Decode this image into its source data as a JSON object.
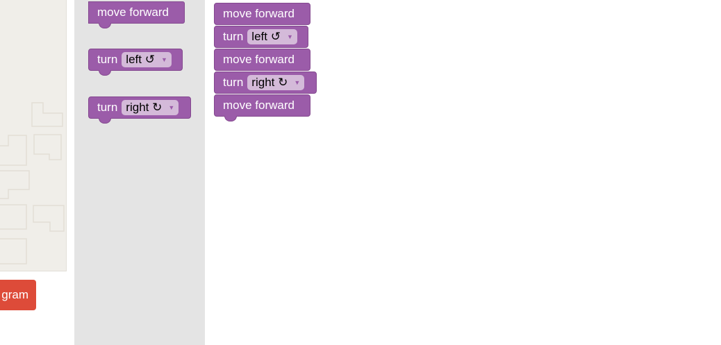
{
  "run_button": {
    "label": "gram"
  },
  "toolbox": {
    "blocks": [
      {
        "label": "move forward"
      },
      {
        "label": "turn",
        "direction": "left ↺"
      },
      {
        "label": "turn",
        "direction": "right ↻"
      }
    ]
  },
  "workspace": {
    "blocks": [
      {
        "label": "move forward"
      },
      {
        "label": "turn",
        "direction": "left ↺"
      },
      {
        "label": "move forward"
      },
      {
        "label": "turn",
        "direction": "right ↻"
      },
      {
        "label": "move forward"
      }
    ]
  },
  "colors": {
    "block": "#9b5ca9",
    "dropdown": "#d4bad9",
    "toolbox_bg": "#e4e4e4",
    "maze_bg": "#f0eee9",
    "run_button": "#dd4b39"
  },
  "icons": {
    "dropdown": "caret-down-icon"
  }
}
